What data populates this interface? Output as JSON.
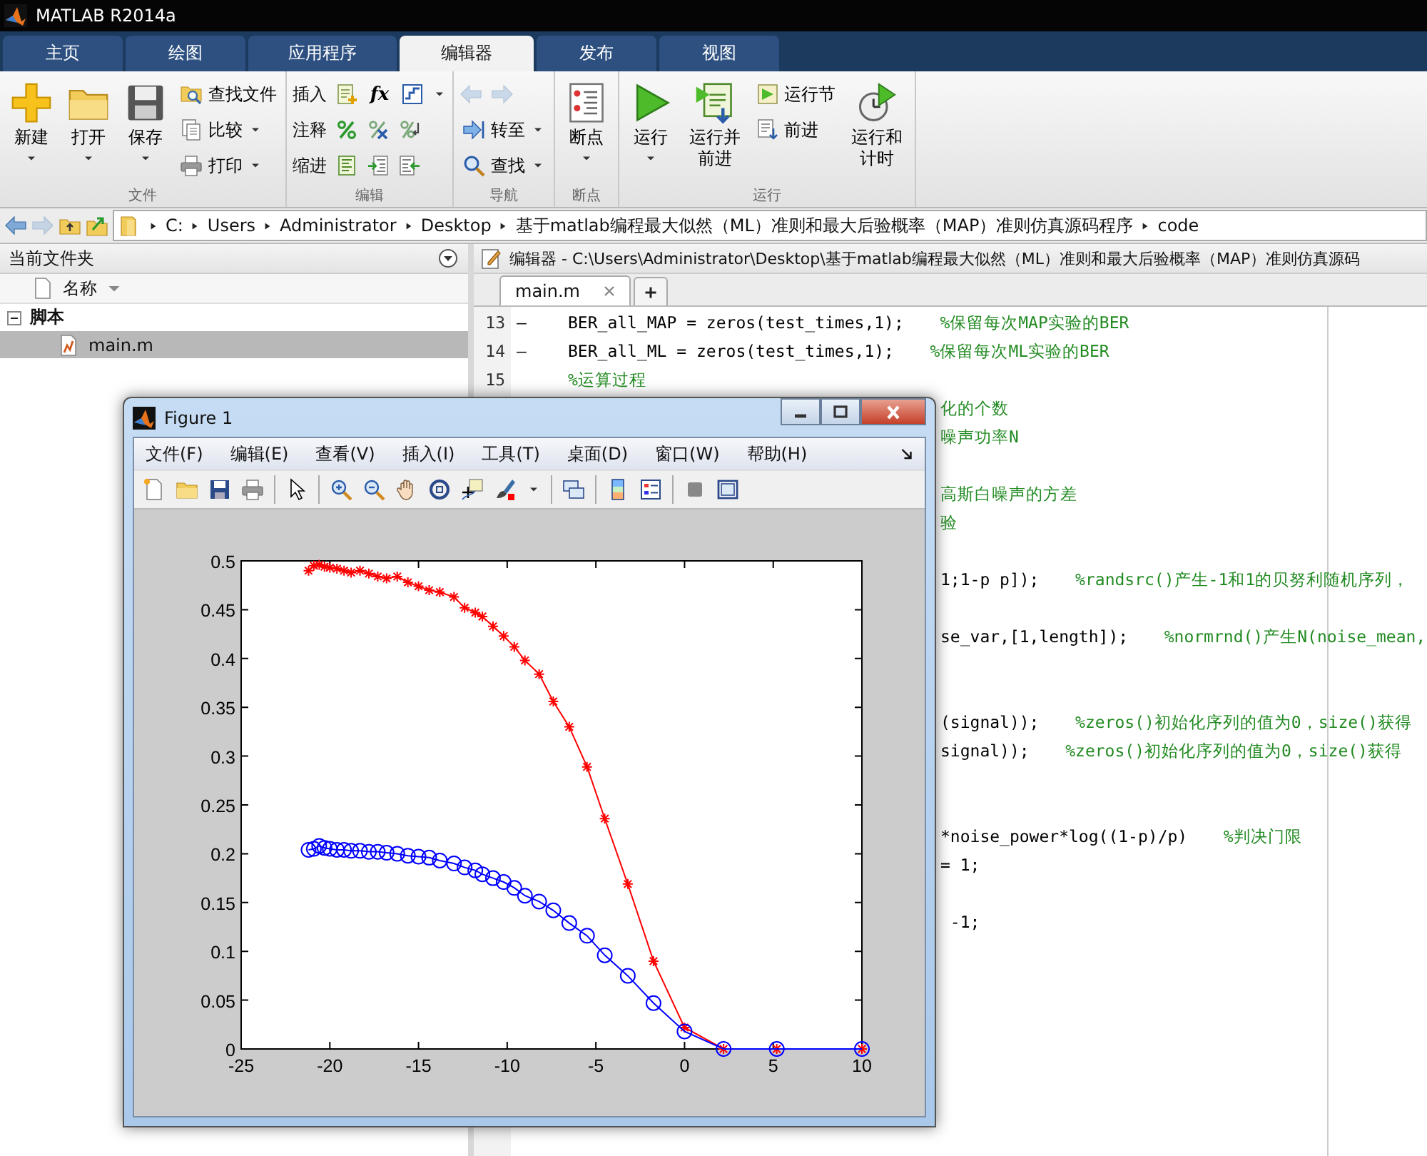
{
  "window": {
    "title": "MATLAB R2014a"
  },
  "tabs": [
    {
      "label": "主页",
      "selected": false
    },
    {
      "label": "绘图",
      "selected": false
    },
    {
      "label": "应用程序",
      "selected": false
    },
    {
      "label": "编辑器",
      "selected": true
    },
    {
      "label": "发布",
      "selected": false
    },
    {
      "label": "视图",
      "selected": false
    }
  ],
  "ribbon": {
    "groups": [
      {
        "label": "文件",
        "items": [
          {
            "kind": "large",
            "label": "新建",
            "dropdown": true
          },
          {
            "kind": "large",
            "label": "打开",
            "dropdown": true
          },
          {
            "kind": "large",
            "label": "保存",
            "dropdown": true
          },
          {
            "kind": "small",
            "label": "查找文件"
          },
          {
            "kind": "small",
            "label": "比较",
            "dropdown": true
          },
          {
            "kind": "small",
            "label": "打印",
            "dropdown": true
          }
        ]
      },
      {
        "label": "编辑",
        "items": [
          {
            "kind": "row",
            "label": "插入",
            "symbol": "fx",
            "dropdown": true
          },
          {
            "kind": "row",
            "label": "注释"
          },
          {
            "kind": "row",
            "label": "缩进"
          }
        ]
      },
      {
        "label": "导航",
        "items": [
          {
            "kind": "arrows",
            "disabled": true
          },
          {
            "kind": "small",
            "label": "转至",
            "dropdown": true
          },
          {
            "kind": "small",
            "label": "查找",
            "dropdown": true
          }
        ]
      },
      {
        "label": "断点",
        "items": [
          {
            "kind": "large",
            "label": "断点",
            "dropdown": true
          }
        ]
      },
      {
        "label": "运行",
        "items": [
          {
            "kind": "large",
            "label": "运行",
            "dropdown": true
          },
          {
            "kind": "large",
            "label": "运行并前进"
          },
          {
            "kind": "small",
            "label": "运行节"
          },
          {
            "kind": "small",
            "label": "前进"
          },
          {
            "kind": "large",
            "label": "运行和计时"
          }
        ]
      }
    ]
  },
  "address_bar": {
    "segments": [
      "C:",
      "Users",
      "Administrator",
      "Desktop",
      "基于matlab编程最大似然（ML）准则和最大后验概率（MAP）准则仿真源码程序",
      "code"
    ]
  },
  "current_folder": {
    "title": "当前文件夹",
    "column": "名称",
    "tree": [
      {
        "label": "脚本",
        "expanded": true,
        "selected": false,
        "children": [
          {
            "label": "main.m",
            "selected": true
          }
        ]
      }
    ]
  },
  "editor": {
    "title": "编辑器 - C:\\Users\\Administrator\\Desktop\\基于matlab编程最大似然（ML）准则和最大后验概率（MAP）准则仿真源码",
    "tabs": [
      {
        "label": "main.m",
        "selected": true
      }
    ],
    "lines": [
      {
        "kind": "full",
        "number": "13",
        "marker": "–",
        "code": "BER_all_MAP = zeros(test_times,1);",
        "comment": "%保留每次MAP实验的BER"
      },
      {
        "kind": "full",
        "number": "14",
        "marker": "–",
        "code": "BER_all_ML = zeros(test_times,1);",
        "comment": "%保留每次ML实验的BER"
      },
      {
        "kind": "full",
        "number": "15",
        "comment": "%运算过程"
      },
      {
        "kind": "fragment",
        "comment": "化的个数"
      },
      {
        "kind": "fragment",
        "comment": "噪声功率N"
      },
      {
        "kind": "fragment"
      },
      {
        "kind": "fragment",
        "comment": "高斯白噪声的方差"
      },
      {
        "kind": "fragment",
        "comment": "验"
      },
      {
        "kind": "fragment"
      },
      {
        "kind": "fragment",
        "code": "1;1-p p]);",
        "comment": "%randsrc()产生-1和1的贝努利随机序列，"
      },
      {
        "kind": "fragment"
      },
      {
        "kind": "fragment",
        "code": "se_var,[1,length]);",
        "comment": "%normrnd()产生N(noise_mean,"
      },
      {
        "kind": "fragment"
      },
      {
        "kind": "fragment"
      },
      {
        "kind": "fragment",
        "code": "(signal));",
        "comment": "%zeros()初始化序列的值为0，size()获得"
      },
      {
        "kind": "fragment",
        "code": "signal));",
        "comment": "%zeros()初始化序列的值为0，size()获得"
      },
      {
        "kind": "fragment"
      },
      {
        "kind": "fragment"
      },
      {
        "kind": "fragment",
        "code": "*noise_power*log((1-p)/p)",
        "comment": "%判决门限"
      },
      {
        "kind": "fragment",
        "code": "= 1;"
      },
      {
        "kind": "fragment"
      },
      {
        "kind": "fragment",
        "code": " -1;"
      }
    ]
  },
  "figure": {
    "title": "Figure 1",
    "menu": [
      "文件(F)",
      "编辑(E)",
      "查看(V)",
      "插入(I)",
      "工具(T)",
      "桌面(D)",
      "窗口(W)",
      "帮助(H)"
    ],
    "chart_data": {
      "type": "line",
      "x": [
        -21.2,
        -20.9,
        -20.6,
        -20.3,
        -20,
        -19.6,
        -19.2,
        -18.8,
        -18.3,
        -17.8,
        -17.3,
        -16.8,
        -16.2,
        -15.6,
        -15,
        -14.4,
        -13.8,
        -13,
        -12.4,
        -11.8,
        -11.4,
        -10.8,
        -10.2,
        -9.6,
        -9,
        -8.2,
        -7.4,
        -6.5,
        -5.5,
        -4.5,
        -3.2,
        -1.75,
        0,
        2.2,
        5.2,
        10
      ],
      "series": [
        {
          "color": "#ff0000",
          "marker": "cross",
          "values": [
            0.49,
            0.495,
            0.496,
            0.494,
            0.493,
            0.492,
            0.49,
            0.488,
            0.49,
            0.487,
            0.484,
            0.482,
            0.484,
            0.478,
            0.474,
            0.47,
            0.468,
            0.463,
            0.452,
            0.447,
            0.443,
            0.433,
            0.423,
            0.412,
            0.398,
            0.384,
            0.356,
            0.33,
            0.289,
            0.236,
            0.169,
            0.09,
            0.022,
            0,
            0,
            0
          ]
        },
        {
          "color": "#0000ff",
          "marker": "circle",
          "values": [
            0.204,
            0.205,
            0.208,
            0.206,
            0.205,
            0.204,
            0.204,
            0.203,
            0.203,
            0.202,
            0.202,
            0.201,
            0.2,
            0.198,
            0.197,
            0.196,
            0.193,
            0.19,
            0.186,
            0.183,
            0.179,
            0.175,
            0.171,
            0.165,
            0.157,
            0.151,
            0.142,
            0.129,
            0.116,
            0.096,
            0.075,
            0.047,
            0.018,
            0,
            0,
            0
          ]
        }
      ],
      "xlim": [
        -25,
        10
      ],
      "ylim": [
        0,
        0.5
      ],
      "xticks": [
        -25,
        -20,
        -15,
        -10,
        -5,
        0,
        5,
        10
      ],
      "yticks": [
        0,
        0.05,
        0.1,
        0.15,
        0.2,
        0.25,
        0.3,
        0.35,
        0.4,
        0.45,
        0.5
      ]
    }
  }
}
